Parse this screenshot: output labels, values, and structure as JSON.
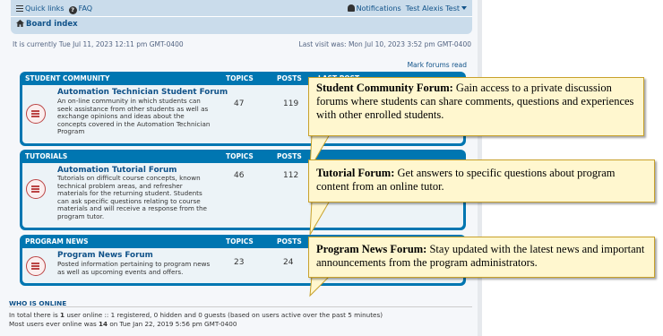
{
  "navbar": {
    "quick_links": "Quick links",
    "faq": "FAQ",
    "notifications": "Notifications",
    "user": "Test Alexis Test",
    "board_index": "Board index"
  },
  "info": {
    "current_time": "It is currently Tue Jul 11, 2023 12:11 pm GMT-0400",
    "last_visit": "Last visit was: Mon Jul 10, 2023 3:52 pm GMT-0400",
    "mark_read": "Mark forums read"
  },
  "columns": {
    "topics": "TOPICS",
    "posts": "POSTS",
    "last_post": "LAST POST"
  },
  "categories": [
    {
      "name": "STUDENT COMMUNITY",
      "forum": {
        "title": "Automation Technician Student Forum",
        "desc": "An on-line community in which students can seek assistance from other students as well as exchange opinions and ideas about the concepts covered in the Automation Technician Program",
        "topics": "47",
        "posts": "119"
      }
    },
    {
      "name": "TUTORIALS",
      "forum": {
        "title": "Automation Tutorial Forum",
        "desc": "Tutorials on difficult course concepts, known technical problem areas, and refresher materials for the returning student. Students can ask specific questions relating to course materials and will receive a response from the program tutor.",
        "topics": "46",
        "posts": "112"
      }
    },
    {
      "name": "PROGRAM NEWS",
      "forum": {
        "title": "Program News Forum",
        "desc": "Posted information pertaining to program news as well as upcoming events and offers.",
        "topics": "23",
        "posts": "24"
      }
    }
  ],
  "who_is_online": {
    "heading": "WHO IS ONLINE",
    "line1_pre": "In total there is ",
    "line1_count": "1",
    "line1_post": " user online :: 1 registered, 0 hidden and 0 guests (based on users active over the past 5 minutes)",
    "line2_pre": "Most users ever online was ",
    "line2_count": "14",
    "line2_post": " on Tue Jan 22, 2019 5:56 pm GMT-0400"
  },
  "callouts": [
    {
      "title": "Student Community Forum:",
      "text": " Gain access to a private discussion forums where students can share comments, questions and experiences with other enrolled students."
    },
    {
      "title": "Tutorial Forum:",
      "text": " Get answers to specific questions about program content from an online tutor."
    },
    {
      "title": "Program News Forum:",
      "text": " Stay updated with the latest news and important announcements from the program administrators."
    }
  ],
  "colors": {
    "header_blue": "#0076b1",
    "row_bg": "#ecf3f7",
    "link": "#105289",
    "callout_bg": "#fff7cf",
    "callout_border": "#c8a12a"
  },
  "icons": [
    "hamburger-icon",
    "question-circle-icon",
    "bell-icon",
    "home-icon",
    "caret-down-icon",
    "forum-read-icon"
  ]
}
